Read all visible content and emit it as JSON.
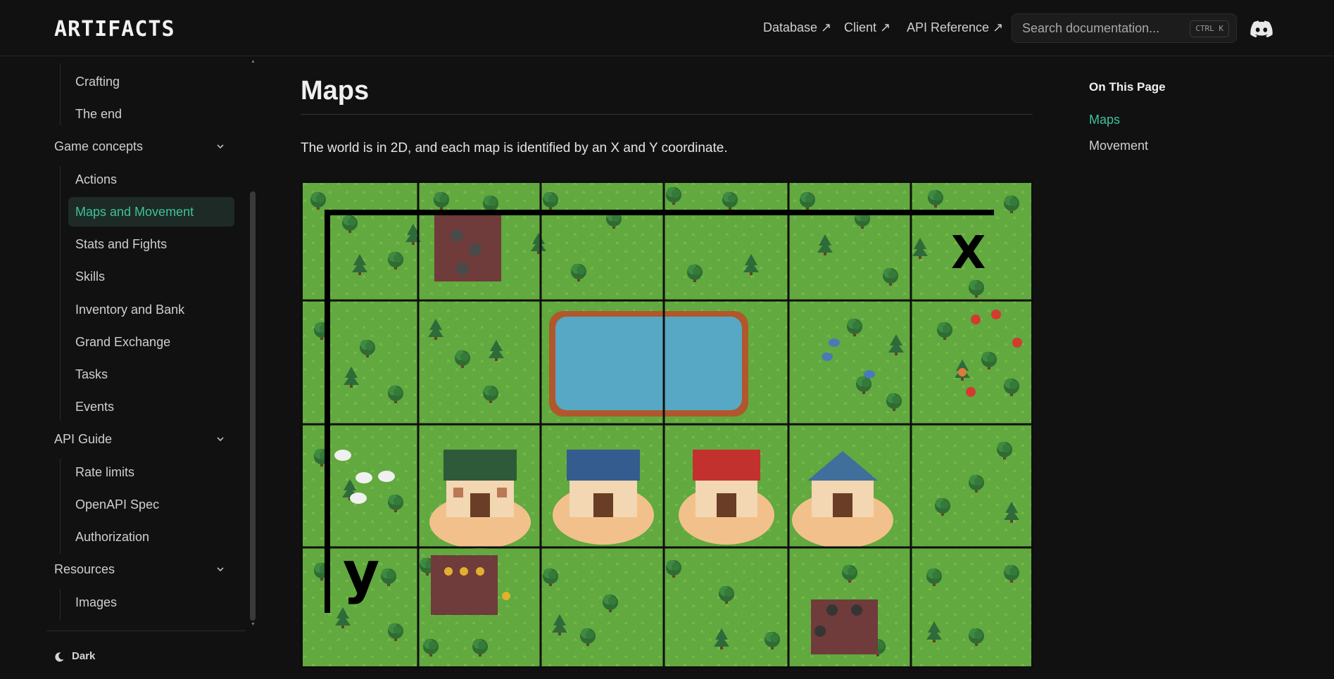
{
  "header": {
    "logo": "ARTIFACTS",
    "nav": [
      {
        "label": "Database ↗"
      },
      {
        "label": "Client ↗"
      },
      {
        "label": "API Reference ↗"
      }
    ],
    "search": {
      "placeholder": "Search documentation...",
      "shortcut": "CTRL K"
    },
    "discord_icon": "discord-icon"
  },
  "sidebar": {
    "top_items": [
      "Crafting",
      "The end"
    ],
    "groups": [
      {
        "label": "Game concepts",
        "items": [
          "Actions",
          "Maps and Movement",
          "Stats and Fights",
          "Skills",
          "Inventory and Bank",
          "Grand Exchange",
          "Tasks",
          "Events"
        ]
      },
      {
        "label": "API Guide",
        "items": [
          "Rate limits",
          "OpenAPI Spec",
          "Authorization"
        ]
      },
      {
        "label": "Resources",
        "items": [
          "Images"
        ]
      }
    ],
    "active_item": "Maps and Movement",
    "accent_color": "#3ec19a",
    "theme_label": "Dark"
  },
  "main": {
    "title": "Maps",
    "intro": "The world is in 2D, and each map is identified by an X and Y coordinate.",
    "map_image": {
      "axis_x_label": "X",
      "axis_y_label": "y",
      "grid_columns": 6,
      "grid_rows": 4
    }
  },
  "on_this_page": {
    "title": "On This Page",
    "links": [
      {
        "label": "Maps",
        "active": true
      },
      {
        "label": "Movement",
        "active": false
      }
    ]
  }
}
